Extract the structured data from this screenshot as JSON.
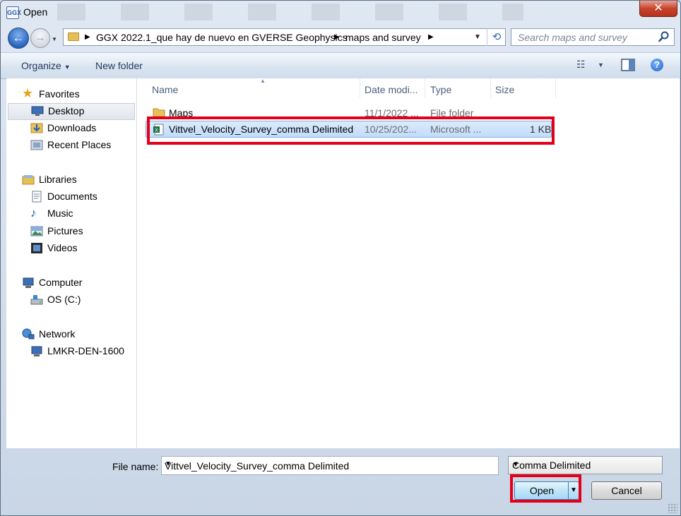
{
  "window": {
    "title": "Open",
    "close_glyph": "✕",
    "app_icon": "GGX"
  },
  "nav": {
    "back_glyph": "←",
    "forward_glyph": "→"
  },
  "address": {
    "crumbs": [
      "GGX 2022.1_que hay de nuevo en GVERSE Geophysics",
      "maps and survey"
    ]
  },
  "search": {
    "placeholder": "Search maps and survey"
  },
  "toolbar": {
    "organize": "Organize",
    "new_folder": "New folder",
    "help_glyph": "?"
  },
  "sidebar": {
    "favorites": {
      "label": "Favorites",
      "items": [
        "Desktop",
        "Downloads",
        "Recent Places"
      ]
    },
    "libraries": {
      "label": "Libraries",
      "items": [
        "Documents",
        "Music",
        "Pictures",
        "Videos"
      ]
    },
    "computer": {
      "label": "Computer",
      "items": [
        "OS (C:)"
      ]
    },
    "network": {
      "label": "Network",
      "items": [
        "LMKR-DEN-1600"
      ]
    }
  },
  "columns": {
    "name": "Name",
    "date": "Date modi...",
    "type": "Type",
    "size": "Size"
  },
  "files": [
    {
      "name": "Maps",
      "date": "11/1/2022 ...",
      "type": "File folder",
      "size": ""
    },
    {
      "name": "Vittvel_Velocity_Survey_comma Delimited",
      "date": "10/25/202...",
      "type": "Microsoft ...",
      "size": "1 KB"
    }
  ],
  "footer": {
    "file_name_label": "File name:",
    "file_name_value": "Vittvel_Velocity_Survey_comma Delimited",
    "filter": "Comma Delimited",
    "open": "Open",
    "cancel": "Cancel"
  },
  "colors": {
    "highlight": "#e4001a",
    "selection": "#c1dcfa"
  }
}
